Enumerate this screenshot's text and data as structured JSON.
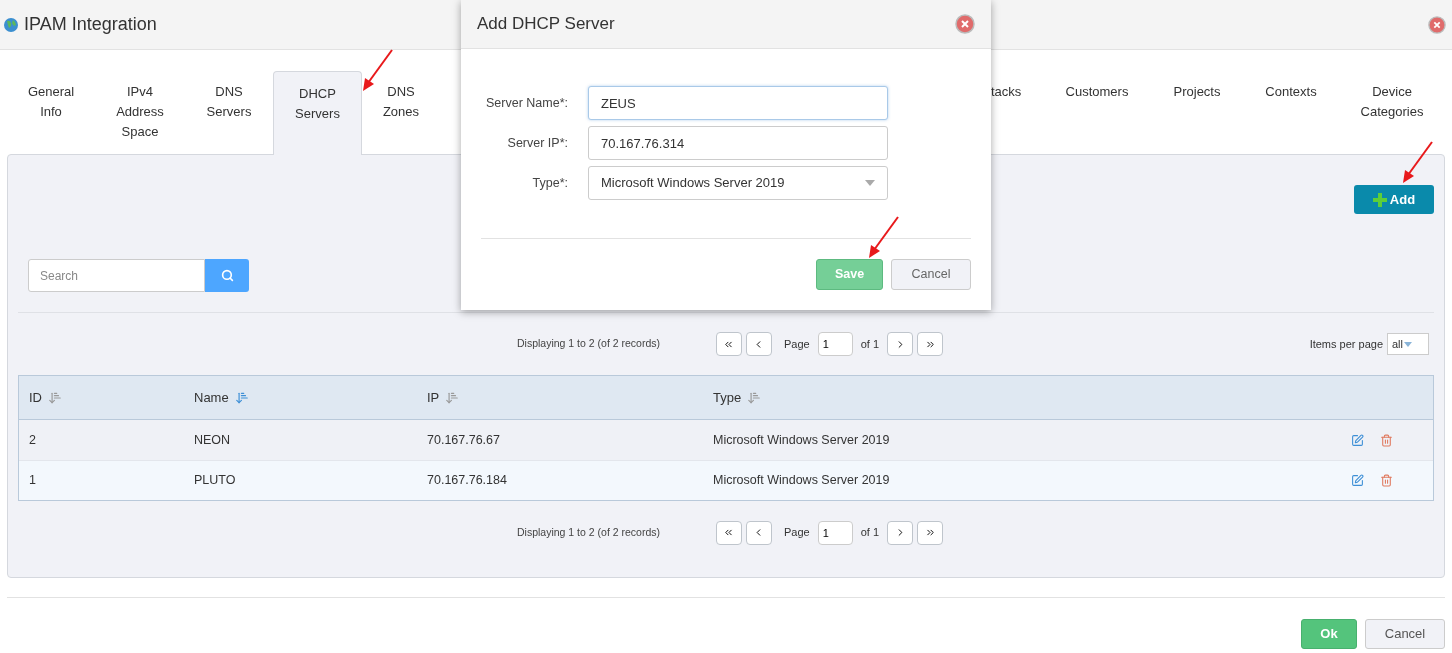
{
  "window": {
    "title": "IPAM Integration"
  },
  "tabs": [
    {
      "label": "General Info",
      "selected": false
    },
    {
      "label": "IPv4 Address Space",
      "selected": false
    },
    {
      "label": "DNS Servers",
      "selected": false
    },
    {
      "label": "DHCP Servers",
      "selected": true
    },
    {
      "label": "DNS Zones",
      "selected": false
    },
    {
      "label": "tacks",
      "selected": false
    },
    {
      "label": "Customers",
      "selected": false
    },
    {
      "label": "Projects",
      "selected": false
    },
    {
      "label": "Contexts",
      "selected": false
    },
    {
      "label": "Device Categories",
      "selected": false
    }
  ],
  "add_button": "Add",
  "search": {
    "placeholder": "Search"
  },
  "pagination_top": {
    "summary": "Displaying 1 to 2 (of 2 records)",
    "page_label": "Page",
    "page": "1",
    "of": "of 1",
    "items_per_page_label": "Items per page",
    "items_per_page": "all"
  },
  "table": {
    "columns": [
      {
        "label": "ID",
        "sorted": false
      },
      {
        "label": "Name",
        "sorted": true
      },
      {
        "label": "IP",
        "sorted": false
      },
      {
        "label": "Type",
        "sorted": false
      }
    ],
    "rows": [
      {
        "id": "2",
        "name": "NEON",
        "ip": "70.167.76.67",
        "type": "Microsoft Windows Server 2019"
      },
      {
        "id": "1",
        "name": "PLUTO",
        "ip": "70.167.76.184",
        "type": "Microsoft Windows Server 2019"
      }
    ]
  },
  "pagination_bottom": {
    "summary": "Displaying 1 to 2 (of 2 records)",
    "page_label": "Page",
    "page": "1",
    "of": "of 1"
  },
  "footer_buttons": {
    "ok": "Ok",
    "cancel": "Cancel"
  },
  "dialog": {
    "title": "Add DHCP Server",
    "fields": [
      {
        "label": "Server Name*:",
        "value": "ZEUS",
        "kind": "text"
      },
      {
        "label": "Server IP*:",
        "value": "70.167.76.314",
        "kind": "text"
      },
      {
        "label": "Type*:",
        "value": "Microsoft Windows Server 2019",
        "kind": "select"
      }
    ],
    "save": "Save",
    "cancel": "Cancel"
  }
}
